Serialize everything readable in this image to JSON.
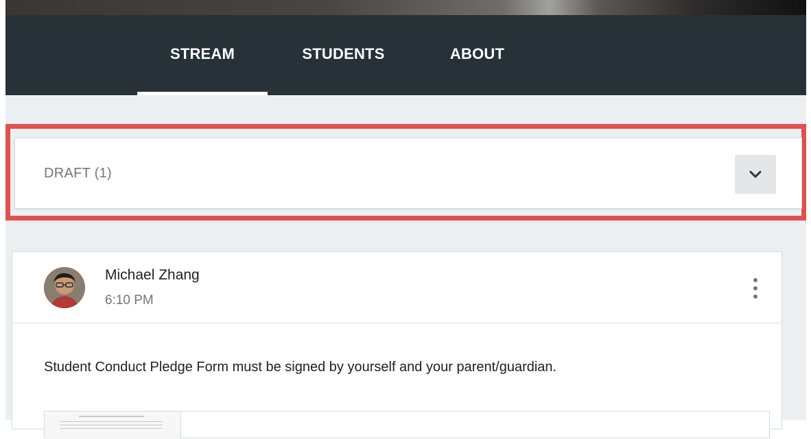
{
  "nav": {
    "tabs": [
      {
        "label": "STREAM",
        "active": true
      },
      {
        "label": "STUDENTS",
        "active": false
      },
      {
        "label": "ABOUT",
        "active": false
      }
    ]
  },
  "draft": {
    "label": "DRAFT (1)",
    "expand_icon": "chevron-down-icon"
  },
  "post": {
    "author": "Michael Zhang",
    "time": "6:10 PM",
    "more_icon": "more-vert-icon",
    "body": "Student Conduct Pledge Form must be signed by yourself and your parent/guardian."
  },
  "colors": {
    "navbar": "#263238",
    "content_bg": "#eceff1",
    "highlight": "#e2504e"
  }
}
